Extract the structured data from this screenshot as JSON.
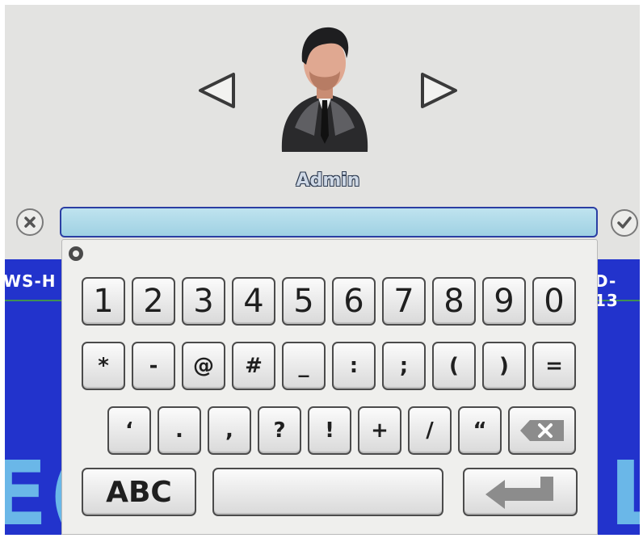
{
  "background": {
    "left_label": "WS-H",
    "right_label": "D-13",
    "left_big": "E(",
    "right_big": "L"
  },
  "login": {
    "username": "Admin",
    "password_value": ""
  },
  "keyboard": {
    "row_numbers": [
      "1",
      "2",
      "3",
      "4",
      "5",
      "6",
      "7",
      "8",
      "9",
      "0"
    ],
    "row_symbols_1": [
      "*",
      "-",
      "@",
      "#",
      "_",
      ":",
      ";",
      "(",
      ")",
      "="
    ],
    "row_symbols_2": [
      "‘",
      ".",
      ",",
      "?",
      "!",
      "+",
      "/",
      "“"
    ],
    "abc_label": "ABC"
  },
  "icons": {
    "cancel": "close-circle-icon",
    "confirm": "check-circle-icon",
    "prev": "triangle-left-icon",
    "next": "triangle-right-icon",
    "backspace": "backspace-icon",
    "enter": "enter-icon"
  },
  "colors": {
    "screen_bg": "#e3e3e1",
    "app_blue": "#2233cc",
    "field_fill": "#a9d7e7",
    "field_border": "#2b3ea3"
  }
}
